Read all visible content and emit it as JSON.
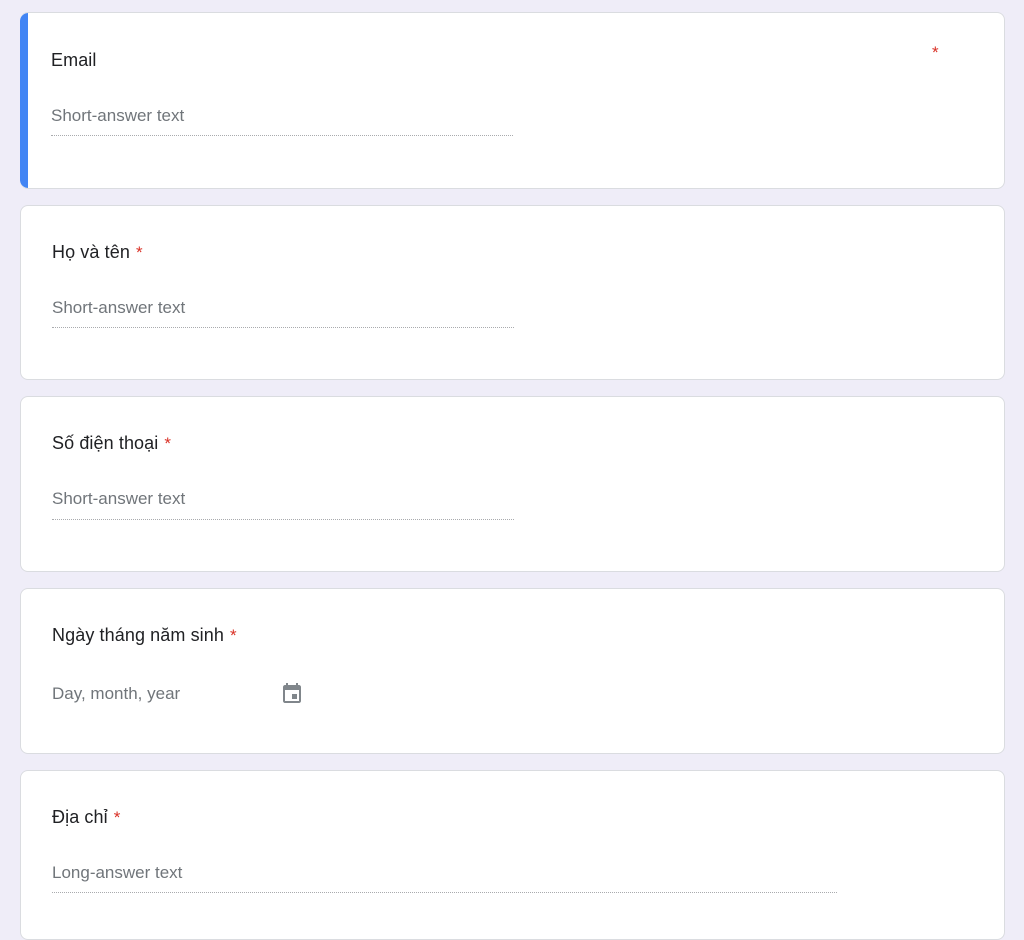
{
  "form": {
    "questions": [
      {
        "title": "Email",
        "required_mark": "*",
        "answer_placeholder": "Short-answer text",
        "answer_type": "short",
        "active": true
      },
      {
        "title": "Họ và tên",
        "required_mark": "*",
        "answer_placeholder": "Short-answer text",
        "answer_type": "short"
      },
      {
        "title": "Số điện thoại",
        "required_mark": "*",
        "answer_placeholder": "Short-answer text",
        "answer_type": "short"
      },
      {
        "title": "Ngày tháng năm sinh",
        "required_mark": "*",
        "answer_placeholder": "Day, month, year",
        "answer_type": "date",
        "icon": "calendar-icon"
      },
      {
        "title": "Địa chỉ",
        "required_mark": "*",
        "answer_placeholder": "Long-answer text",
        "answer_type": "long"
      }
    ]
  },
  "colors": {
    "page_background": "#efedf8",
    "card_background": "#ffffff",
    "active_accent": "#4285f4",
    "required": "#d93025",
    "placeholder_text": "#70757a",
    "title_text": "#202124"
  }
}
